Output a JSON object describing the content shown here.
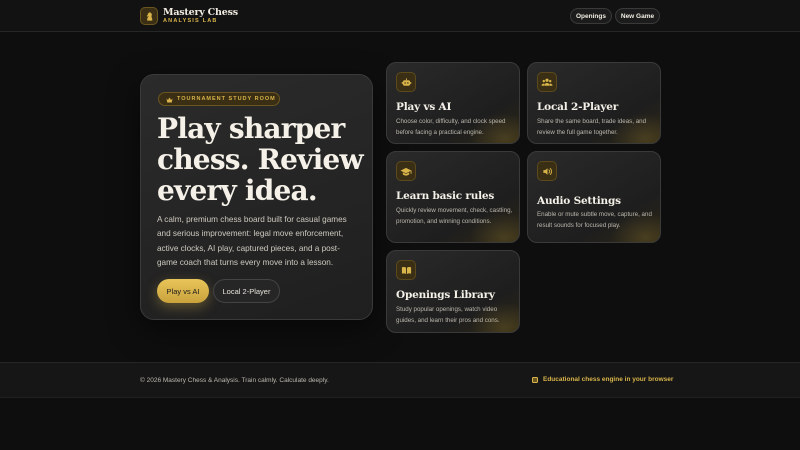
{
  "brand": {
    "title": "Mastery Chess",
    "subtitle": "ANALYSIS LAB",
    "logo_icon": "chess-knight-icon"
  },
  "nav": {
    "openings_label": "Openings",
    "new_game_label": "New Game"
  },
  "hero": {
    "badge_icon": "crown-icon",
    "badge_label": "TOURNAMENT STUDY ROOM",
    "title": "Play sharper chess. Review every idea.",
    "description": "A calm, premium chess board built for casual games and serious improvement: legal move enforcement, active clocks, AI play, captured pieces, and a post-game coach that turns every move into a lesson.",
    "primary_button": "Play vs AI",
    "secondary_button": "Local 2-Player"
  },
  "cards": [
    {
      "icon": "robot-icon",
      "title": "Play vs AI",
      "description": "Choose color, difficulty, and clock speed before facing a practical engine."
    },
    {
      "icon": "users-icon",
      "title": "Local 2-Player",
      "description": "Share the same board, trade ideas, and review the full game together."
    },
    {
      "icon": "graduation-cap-icon",
      "title": "Learn basic rules",
      "description": "Quickly review movement, check, castling, promotion, and winning conditions."
    },
    {
      "icon": "speaker-icon",
      "title": "Audio Settings",
      "description": "Enable or mute subtle move, capture, and result sounds for focused play."
    },
    {
      "icon": "book-icon",
      "title": "Openings Library",
      "description": "Study popular openings, watch video guides, and learn their pros and cons."
    }
  ],
  "footer": {
    "copyright": "© 2026 Mastery Chess & Analysis. Train calmly. Calculate deeply.",
    "note_icon": "chip-icon",
    "note": "Educational chess engine in your browser"
  },
  "colors": {
    "accent": "#d8b44a",
    "background": "#0e0e0e",
    "card": "#242424"
  }
}
